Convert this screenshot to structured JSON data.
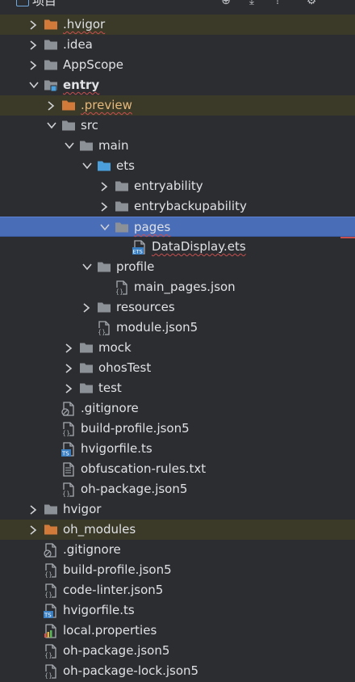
{
  "toolbar": {
    "title": "项目",
    "icons": [
      "project-icon",
      "target-icon",
      "download-icon",
      "collapse-icon",
      "gear-icon"
    ]
  },
  "colors": {
    "background": "#2b2d30",
    "excluded_row": "#3b3928",
    "selected_row": "#4a6db7",
    "folder_gray": "#8c9097",
    "folder_orange": "#d27a3a",
    "folder_blue": "#4a9fdc",
    "warning": "#c94f4f"
  },
  "tree": [
    {
      "label": ".hvigor",
      "icon": "folder-orange-icon",
      "expand": "collapsed",
      "excluded": true,
      "warn": true,
      "selected": false
    },
    {
      "label": ".idea",
      "icon": "folder-icon",
      "expand": "collapsed",
      "excluded": false,
      "warn": false,
      "selected": false
    },
    {
      "label": "AppScope",
      "icon": "folder-icon",
      "expand": "collapsed",
      "excluded": false,
      "warn": false,
      "selected": false
    },
    {
      "label": "entry",
      "icon": "module-folder-icon",
      "expand": "expanded",
      "excluded": false,
      "warn": true,
      "bold": true,
      "selected": false
    },
    {
      "label": ".preview",
      "icon": "folder-orange-icon",
      "expand": "collapsed",
      "excluded": true,
      "warn": true,
      "orange": true,
      "selected": false
    },
    {
      "label": "src",
      "icon": "folder-icon",
      "expand": "expanded",
      "excluded": false,
      "warn": false,
      "selected": false
    },
    {
      "label": "main",
      "icon": "folder-icon",
      "expand": "expanded",
      "excluded": false,
      "warn": false,
      "selected": false
    },
    {
      "label": "ets",
      "icon": "folder-blue-icon",
      "expand": "expanded",
      "excluded": false,
      "warn": false,
      "selected": false
    },
    {
      "label": "entryability",
      "icon": "folder-icon",
      "expand": "collapsed",
      "excluded": false,
      "warn": false,
      "selected": false
    },
    {
      "label": "entrybackupability",
      "icon": "folder-icon",
      "expand": "collapsed",
      "excluded": false,
      "warn": false,
      "selected": false
    },
    {
      "label": "pages",
      "icon": "folder-icon",
      "expand": "expanded",
      "excluded": false,
      "warn": true,
      "selected": true
    },
    {
      "label": "DataDisplay.ets",
      "icon": "ets-file-icon",
      "expand": "none",
      "excluded": false,
      "warn": true,
      "selected": false
    },
    {
      "label": "profile",
      "icon": "folder-icon",
      "expand": "expanded",
      "excluded": false,
      "warn": false,
      "selected": false
    },
    {
      "label": "main_pages.json",
      "icon": "json-file-icon",
      "expand": "none",
      "excluded": false,
      "warn": false,
      "selected": false
    },
    {
      "label": "resources",
      "icon": "folder-icon",
      "expand": "collapsed",
      "excluded": false,
      "warn": false,
      "selected": false
    },
    {
      "label": "module.json5",
      "icon": "json-file-icon",
      "expand": "none",
      "excluded": false,
      "warn": false,
      "selected": false
    },
    {
      "label": "mock",
      "icon": "folder-icon",
      "expand": "collapsed",
      "excluded": false,
      "warn": false,
      "selected": false
    },
    {
      "label": "ohosTest",
      "icon": "folder-icon",
      "expand": "collapsed",
      "excluded": false,
      "warn": false,
      "selected": false
    },
    {
      "label": "test",
      "icon": "folder-icon",
      "expand": "collapsed",
      "excluded": false,
      "warn": false,
      "selected": false
    },
    {
      "label": ".gitignore",
      "icon": "gitignore-file-icon",
      "expand": "none",
      "excluded": false,
      "warn": false,
      "selected": false
    },
    {
      "label": "build-profile.json5",
      "icon": "json-file-icon",
      "expand": "none",
      "excluded": false,
      "warn": false,
      "selected": false
    },
    {
      "label": "hvigorfile.ts",
      "icon": "ts-file-icon",
      "expand": "none",
      "excluded": false,
      "warn": false,
      "selected": false
    },
    {
      "label": "obfuscation-rules.txt",
      "icon": "text-file-icon",
      "expand": "none",
      "excluded": false,
      "warn": false,
      "selected": false
    },
    {
      "label": "oh-package.json5",
      "icon": "json-file-icon",
      "expand": "none",
      "excluded": false,
      "warn": false,
      "selected": false
    },
    {
      "label": "hvigor",
      "icon": "folder-icon",
      "expand": "collapsed",
      "excluded": false,
      "warn": false,
      "selected": false
    },
    {
      "label": "oh_modules",
      "icon": "folder-orange-icon",
      "expand": "collapsed",
      "excluded": true,
      "warn": false,
      "selected": false
    },
    {
      "label": ".gitignore",
      "icon": "gitignore-file-icon",
      "expand": "none",
      "excluded": false,
      "warn": false,
      "selected": false
    },
    {
      "label": "build-profile.json5",
      "icon": "json-file-icon",
      "expand": "none",
      "excluded": false,
      "warn": false,
      "selected": false
    },
    {
      "label": "code-linter.json5",
      "icon": "json-file-icon",
      "expand": "none",
      "excluded": false,
      "warn": false,
      "selected": false
    },
    {
      "label": "hvigorfile.ts",
      "icon": "ts-file-icon",
      "expand": "none",
      "excluded": false,
      "warn": false,
      "selected": false
    },
    {
      "label": "local.properties",
      "icon": "properties-file-icon",
      "expand": "none",
      "excluded": false,
      "warn": false,
      "selected": false
    },
    {
      "label": "oh-package.json5",
      "icon": "json-file-icon",
      "expand": "none",
      "excluded": false,
      "warn": false,
      "selected": false
    },
    {
      "label": "oh-package-lock.json5",
      "icon": "json-file-icon",
      "expand": "none",
      "excluded": false,
      "warn": false,
      "selected": false
    }
  ]
}
